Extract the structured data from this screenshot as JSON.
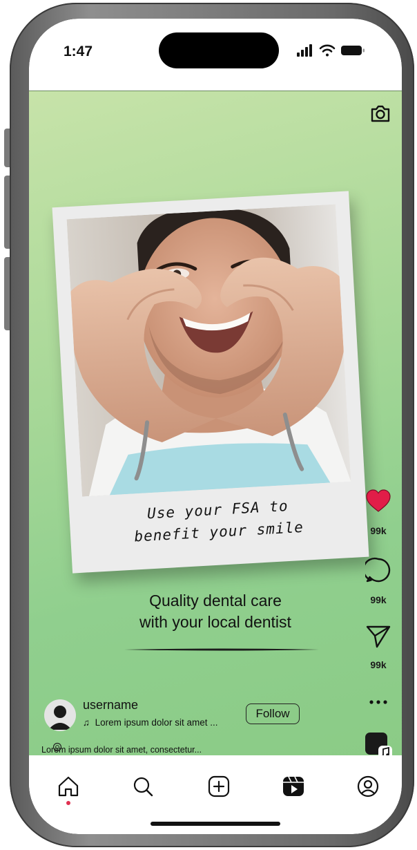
{
  "status_bar": {
    "time": "1:47",
    "icons": [
      "signal-icon",
      "wifi-icon",
      "battery-icon"
    ]
  },
  "post": {
    "caption_line1": "Use your FSA to",
    "caption_line2": "benefit your smile",
    "headline_line1": "Quality dental care",
    "headline_line2": "with your local dentist"
  },
  "actions": {
    "like_count": "99k",
    "comment_count": "99k",
    "share_count": "99k",
    "more_label": "..."
  },
  "author": {
    "username": "username",
    "song": "Lorem ipsum dolor sit amet ...",
    "follow_label": "Follow",
    "description": "Lorem ipsum dolor sit amet, consectetur..."
  },
  "nav": {
    "items": [
      "home-icon",
      "search-icon",
      "create-icon",
      "reels-icon",
      "profile-icon"
    ],
    "active": "home-icon"
  },
  "colors": {
    "like": "#e11d48",
    "background_top": "#c7e3a9",
    "background_bottom": "#8bcb86",
    "active_dot": "#e03050"
  }
}
